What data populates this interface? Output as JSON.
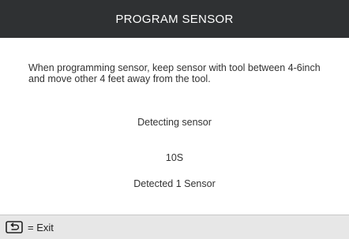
{
  "header": {
    "title": "PROGRAM SENSOR"
  },
  "main": {
    "instructions": "When programming sensor, keep sensor with tool between 4-6inch and move other 4 feet away from the tool.",
    "status": "Detecting sensor",
    "countdown": "10S",
    "result": "Detected 1 Sensor"
  },
  "footer": {
    "exit_icon": "back-icon",
    "exit_label": "= Exit"
  }
}
